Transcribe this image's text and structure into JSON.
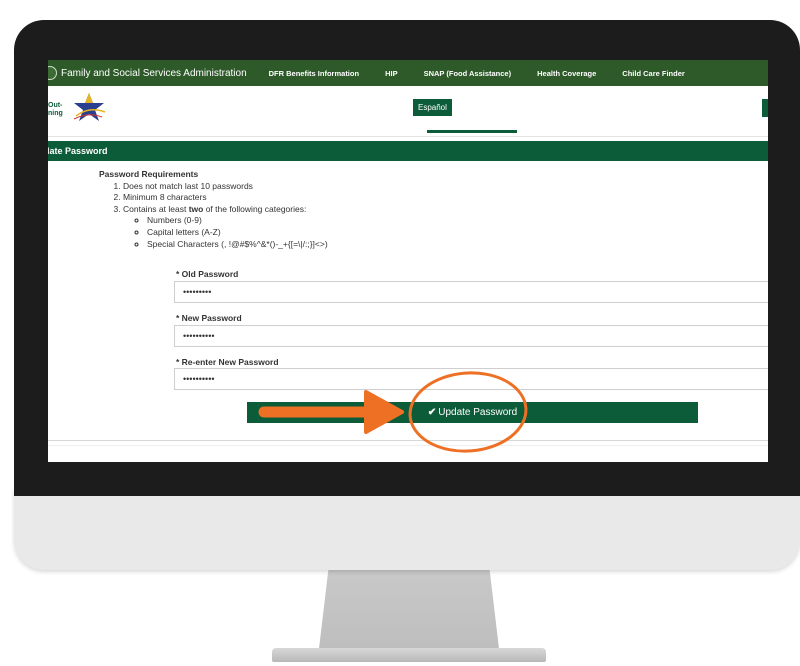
{
  "topnav": {
    "title": "Family and Social Services Administration",
    "links": [
      "DFR Benefits Information",
      "HIP",
      "SNAP (Food Assistance)",
      "Health Coverage",
      "Child Care Finder"
    ]
  },
  "header": {
    "logo_text_line1": "Out-",
    "logo_text_line2": "ning",
    "language_button": "Español"
  },
  "section": {
    "title": "date Password"
  },
  "requirements": {
    "title": "Password Requirements",
    "items": [
      "Does not match last 10 passwords",
      "Minimum 8 characters"
    ],
    "item3_before": "Contains at least ",
    "item3_bold": "two",
    "item3_after": " of the following categories:",
    "categories": [
      "Numbers (0-9)",
      "Capital letters (A-Z)",
      "Special Characters (, !@#$%^&*()-_+{[=\\|/:;}]<>)"
    ]
  },
  "form": {
    "old_label": "* Old Password",
    "old_value": "•••••••••",
    "new_label": "* New Password",
    "new_value": "••••••••••",
    "reenter_label": "* Re-enter New Password",
    "reenter_value": "••••••••••"
  },
  "submit": {
    "icon": "check-icon",
    "label": "Update Password"
  },
  "colors": {
    "nav_green": "#2e5a2a",
    "brand_green": "#0c5c39",
    "annotation_orange": "#ee7024"
  }
}
